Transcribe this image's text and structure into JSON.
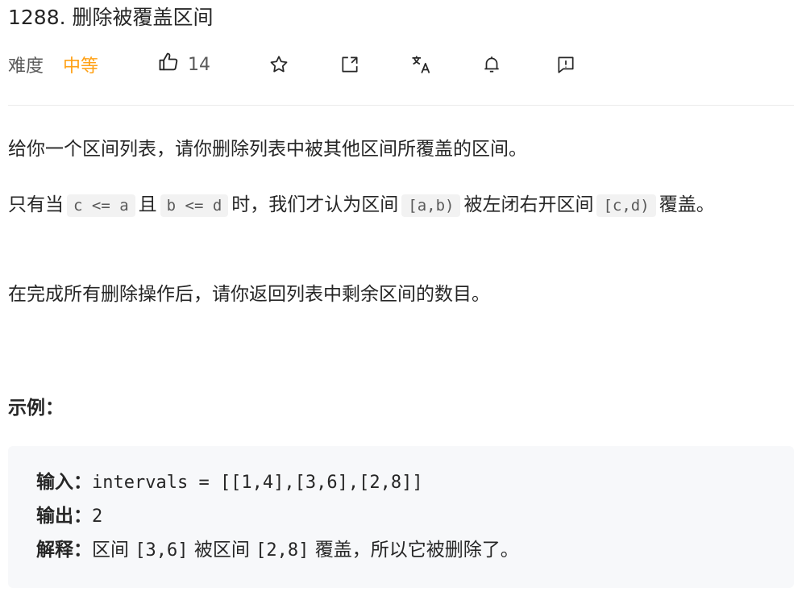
{
  "problem": {
    "title": "1288. 删除被覆盖区间",
    "difficulty_label": "难度",
    "difficulty_value": "中等",
    "likes": "14"
  },
  "toolbar": {
    "icons": [
      "thumbs-up-icon",
      "star-icon",
      "share-icon",
      "translate-icon",
      "bell-icon",
      "feedback-icon"
    ]
  },
  "description": {
    "p1": "给你一个区间列表，请你删除列表中被其他区间所覆盖的区间。",
    "p2": {
      "t1": "只有当",
      "c1": "c <= a",
      "t2": "且",
      "c2": "b <= d",
      "t3": "时，我们才认为区间",
      "c3": "[a,b)",
      "t4": "被左闭右开区间",
      "c4": "[c,d)",
      "t5": "覆盖。"
    },
    "p3": "在完成所有删除操作后，请你返回列表中剩余区间的数目。"
  },
  "example": {
    "heading": "示例：",
    "input_label": "输入：",
    "input_value": "intervals = [[1,4],[3,6],[2,8]]",
    "output_label": "输出：",
    "output_value": "2",
    "explain_label": "解释：",
    "explain_t1": "区间 ",
    "explain_c1": "[3,6]",
    "explain_t2": " 被区间 ",
    "explain_c2": "[2,8]",
    "explain_t3": " 覆盖，所以它被删除了。"
  },
  "colors": {
    "accent": "#ffa116",
    "code_bg": "#f2f2f2",
    "example_bg": "#f7f8fa"
  }
}
